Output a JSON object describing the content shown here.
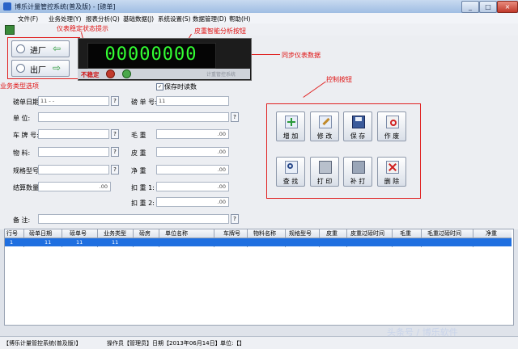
{
  "window": {
    "title": "博乐计量管控系统(普及版) - [磅单]",
    "min": "_",
    "max": "□",
    "close": "×"
  },
  "menu": [
    "文件(F)",
    "业务处理(Y)",
    "报表分析(Q)",
    "基础数据(J)",
    "系统设置(S)",
    "数据管理(D)",
    "帮助(H)"
  ],
  "annotations": {
    "stable_tip": "仪表稳定状态提示",
    "tare_btn": "皮重智能分析按钮",
    "sync_data": "同步仪表数据",
    "biz_type": "业务类型选项",
    "control": "控制按钮"
  },
  "direction": {
    "in": "进厂",
    "out": "出厂"
  },
  "meter": {
    "value": "00000000",
    "status": "不稳定",
    "brand": "计重管控系统"
  },
  "save_read": "保存时读数",
  "form": {
    "date_label": "磅单日期:",
    "date_value": "11  -  -",
    "no_label": "磅 单 号:",
    "no_value": "11",
    "unit_label": "单    位:",
    "plate_label": "车 牌 号:",
    "gross_label": "毛    重",
    "goods_label": "物    料:",
    "tare_label": "皮    重",
    "spec_label": "规格型号:",
    "net_label": "净    重",
    "qty_label": "结算数量:",
    "qty_value": ".00",
    "deduct1_label": "扣 重 1:",
    "deduct2_label": "扣 重 2:",
    "remark_label": "备    注:",
    "zero": ".00",
    "q": "?"
  },
  "controls": [
    "增 加",
    "修 改",
    "保 存",
    "作 废",
    "查 找",
    "打 印",
    "补 打",
    "删 除"
  ],
  "table": {
    "headers": [
      "行号",
      "磅单日期",
      "磅单号",
      "业务类型",
      "磅房",
      "单位名称",
      "车牌号",
      "物料名称",
      "规格型号",
      "皮重",
      "皮重过磅时间",
      "毛重",
      "毛重过磅时间",
      "净重"
    ],
    "row": [
      "1",
      "11",
      "11",
      "11"
    ]
  },
  "status": {
    "app": "【博乐计量管控系统(普及版)】",
    "operator": "操作员【管理员】",
    "date": "日期【2013年06月14日】",
    "unit": "单位:【】"
  },
  "watermark": "头条号 / 博乐软件",
  "colors": {
    "accent": "#1f6fe0",
    "annotation": "#e02020",
    "meter_digits": "#33ff33"
  }
}
